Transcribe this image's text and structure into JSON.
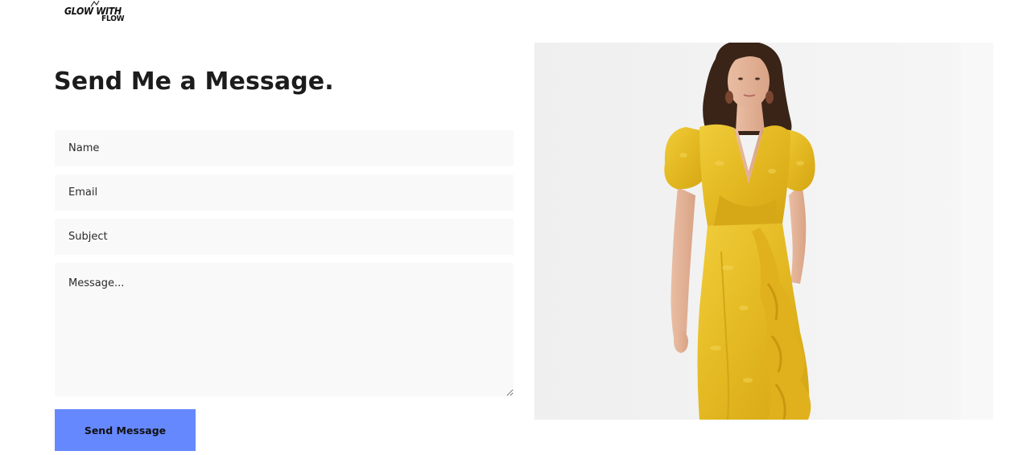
{
  "logo": {
    "line1": "GLOW WITH",
    "line2": "FLOW"
  },
  "contact": {
    "title": "Send Me a Message.",
    "name_placeholder": "Name",
    "email_placeholder": "Email",
    "subject_placeholder": "Subject",
    "message_placeholder": "Message...",
    "send_label": "Send Message"
  },
  "colors": {
    "button": "#6688ff",
    "field_bg": "#f9f9f9",
    "dress": "#e9c22b"
  }
}
